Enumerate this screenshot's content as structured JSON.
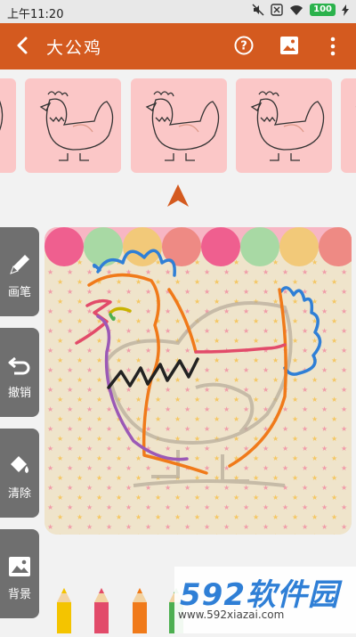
{
  "status_bar": {
    "time": "上午11:20",
    "battery": "100",
    "icons": [
      "mute-icon",
      "close-box-icon",
      "wifi-icon",
      "battery-icon",
      "bolt-icon"
    ]
  },
  "app_bar": {
    "title": "大公鸡",
    "actions": [
      "help-icon",
      "gallery-icon",
      "more-icon"
    ],
    "color": "#d45a1f"
  },
  "tools": [
    {
      "label": "画笔",
      "icon": "pencil-icon"
    },
    {
      "label": "撤销",
      "icon": "undo-icon"
    },
    {
      "label": "清除",
      "icon": "bucket-icon"
    },
    {
      "label": "背景",
      "icon": "image-icon"
    }
  ],
  "pencil_colors": [
    "#f4c400",
    "#e24b6a",
    "#f07a1a",
    "#4caf50",
    "#2f7fd6",
    "#222222",
    "#9b59b6"
  ],
  "watermark": {
    "brand": "592软件园",
    "url": "www.592xiazai.com"
  }
}
